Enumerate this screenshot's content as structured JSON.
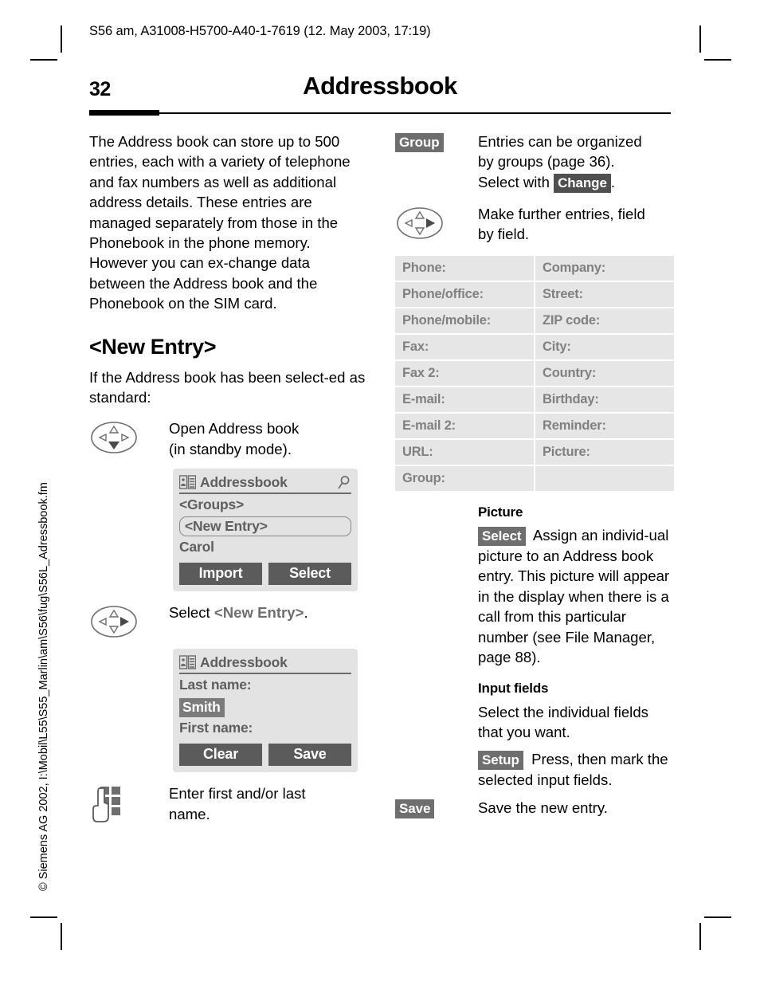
{
  "running_head": "S56 am, A31008-H5700-A40-1-7619 (12. May 2003, 17:19)",
  "page": {
    "number": "32",
    "chapter_title": "Addressbook",
    "sidebar_note": "© Siemens AG 2002, I:\\Mobil\\L55\\S55_Marlin\\am\\S56\\fug\\S56L_Adressbook.fm"
  },
  "left": {
    "intro": "The Address book can store up to 500 entries, each with a variety of telephone and fax numbers as well as additional address details. These entries are managed separately from those in the Phonebook in the phone memory. However you can ex-change data between the Address book and the Phonebook on the SIM card.",
    "section_title": "<New Entry>",
    "standard_text": "If the Address book has been select-ed as standard:",
    "step1_text_line1": "Open Address book",
    "step1_text_line2": "(in standby mode).",
    "screen1": {
      "title": "Addressbook",
      "icon": "addressbook-icon",
      "search_icon": "magnifier-icon",
      "items": [
        "<Groups>",
        "<New Entry>",
        "Carol"
      ],
      "selected_item": "<New Entry>",
      "softkey_left": "Import",
      "softkey_right": "Select"
    },
    "step2_prefix": "Select ",
    "step2_bold": "<New Entry>",
    "step2_suffix": ".",
    "screen2": {
      "title": "Addressbook",
      "icon": "addressbook-icon",
      "label_last": "Last name:",
      "value_last": "Smith",
      "label_first": "First name:",
      "softkey_left": "Clear",
      "softkey_right": "Save"
    },
    "step3_text_line1": "Enter first and/or last",
    "step3_text_line2": "name."
  },
  "right": {
    "group_chip": "Group",
    "group_text_1": "Entries can be organized",
    "group_text_2": "by groups (page 36).",
    "group_text_3_prefix": "Select with ",
    "group_text_3_chip": "Change",
    "group_text_3_suffix": ".",
    "nav_text_line1": "Make further entries, field",
    "nav_text_line2": "by field.",
    "fields": [
      [
        "Phone:",
        "Company:"
      ],
      [
        "Phone/office:",
        "Street:"
      ],
      [
        "Phone/mobile:",
        "ZIP code:"
      ],
      [
        "Fax:",
        "City:"
      ],
      [
        "Fax 2:",
        "Country:"
      ],
      [
        "E-mail:",
        "Birthday:"
      ],
      [
        "E-mail 2:",
        "Reminder:"
      ],
      [
        "URL:",
        "Picture:"
      ],
      [
        "Group:",
        ""
      ]
    ],
    "picture_heading": "Picture",
    "picture_chip": "Select",
    "picture_text": "Assign an individ-ual picture to an Address book entry. This picture will appear in the display when there is a call from this particular number (see File Manager, page 88).",
    "input_heading": "Input fields",
    "input_text": "Select the individual fields that you want.",
    "setup_chip": "Setup",
    "setup_text": "Press, then mark the selected input fields.",
    "save_chip": "Save",
    "save_text": "Save the new entry."
  },
  "colors": {
    "chip_bg": "#6e6e6e",
    "field_bg": "#e6e6e6",
    "field_text": "#808080",
    "screen_bg": "#e3e3e3",
    "softkey_bg": "#5b5b5b"
  }
}
